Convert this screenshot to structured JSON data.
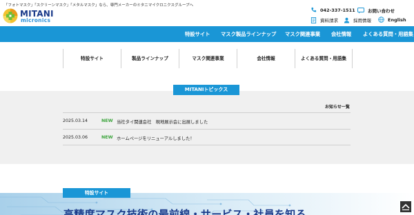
{
  "header": {
    "tagline": "「フォトマスク」「スクリーンマスク」「メタルマスク」なら、専門メーカーのミタニマイクロニクスグループへ",
    "logo_main": "MITANI",
    "logo_sub": "micronics",
    "phone": "042-337-1511",
    "contact_label": "お問い合わせ",
    "request_docs_label": "資料請求",
    "recruit_label": "採用情報",
    "english_label": "English"
  },
  "nav": {
    "items": [
      "特設サイト",
      "マスク製品ラインナップ",
      "マスク関連事業",
      "会社情報",
      "よくある質問・用語集"
    ]
  },
  "subnav": {
    "items": [
      "特設サイト",
      "製品ラインナップ",
      "マスク関連事業",
      "会社情報",
      "よくある質問・用語集"
    ]
  },
  "topics": {
    "heading": "MITANIトピックス",
    "news_list_label": "お知らせ一覧",
    "items": [
      {
        "date": "2025.03.14",
        "badge": "NEW",
        "text": "当社タイ関連会社　現地展示会に出展しました"
      },
      {
        "date": "2025.03.06",
        "badge": "NEW",
        "text": "ホームページをリニューアルしました！"
      }
    ]
  },
  "special": {
    "label": "特設サイト",
    "title": "高精度マスク技術の最前線・サービス・社員を知る"
  },
  "colors": {
    "nav_blue": "#1a96d6",
    "logo_navy": "#1a3a8a",
    "new_green": "#3aa33a"
  }
}
